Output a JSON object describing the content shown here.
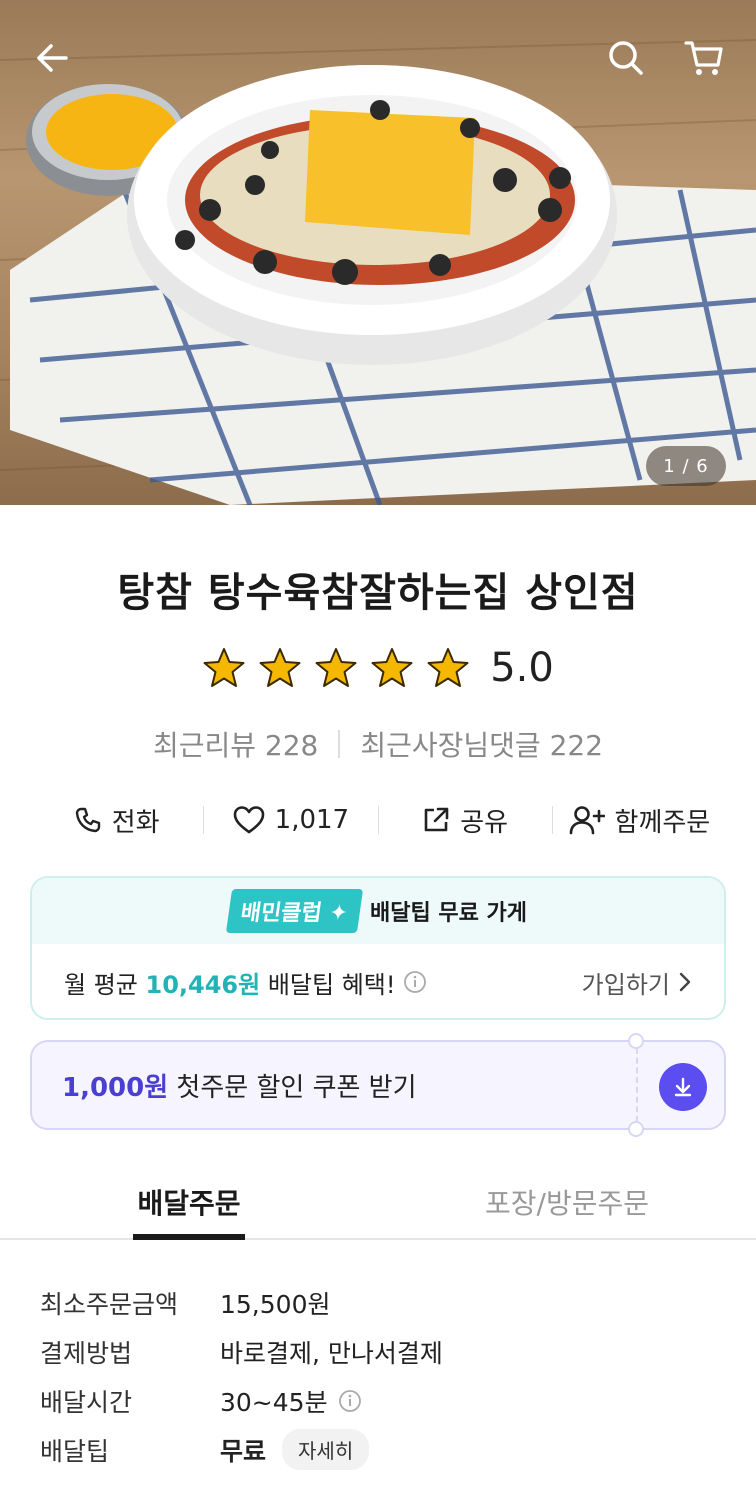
{
  "hero": {
    "counter": "1 / 6"
  },
  "store": {
    "name": "탕참 탕수육참잘하는집 상인점",
    "rating": "5.0",
    "star_count": 5,
    "recent_reviews": "최근리뷰 228",
    "owner_replies": "최근사장님댓글 222"
  },
  "actions": {
    "call": "전화",
    "likes": "1,017",
    "share": "공유",
    "group_order": "함께주문"
  },
  "club": {
    "badge": "배민클럽",
    "headline": "배달팁 무료 가게",
    "prefix": "월 평균 ",
    "amount": "10,446원",
    "suffix": " 배달팁 혜택!",
    "join": "가입하기"
  },
  "coupon": {
    "amount": "1,000원",
    "text": " 첫주문 할인 쿠폰 받기"
  },
  "tabs": {
    "delivery": "배달주문",
    "pickup": "포장/방문주문"
  },
  "info": {
    "min_order_label": "최소주문금액",
    "min_order_value": "15,500원",
    "payment_label": "결제방법",
    "payment_value": "바로결제, 만나서결제",
    "delivery_time_label": "배달시간",
    "delivery_time_value": "30~45분",
    "delivery_tip_label": "배달팁",
    "delivery_tip_value": "무료",
    "detail_chip": "자세히"
  },
  "colors": {
    "club_accent": "#21b3b5",
    "coupon_accent": "#4b3fd1",
    "download_button": "#5b4df0",
    "star": "#f5b800"
  }
}
